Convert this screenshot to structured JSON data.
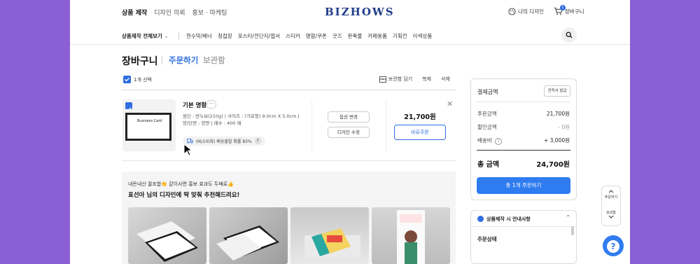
{
  "top_nav": {
    "items": [
      "상품 제작",
      "디자인 의뢰",
      "홍보 · 마케팅"
    ]
  },
  "logo": "BIZHOWS",
  "top_right": {
    "my_design": "나의 디자인",
    "cart": "장바구니",
    "cart_count": "1"
  },
  "category_bar": {
    "all_label": "상품제작 전체보기",
    "items": [
      "현수막/배너",
      "청첩장",
      "포스터/전단지/엽서",
      "스티커",
      "명함/쿠폰",
      "굿즈",
      "판촉물",
      "카페용품",
      "기획전",
      "이색상품"
    ]
  },
  "cart_header": {
    "title": "장바구니",
    "tab_order": "주문하기",
    "tab_keep": "보관함"
  },
  "selection": {
    "count_label": "1개 선택",
    "keep_label": "보관함 담기",
    "copy_label": "복제",
    "delete_label": "삭제"
  },
  "product": {
    "name": "기본 명함",
    "more": "···",
    "desc_line1": "원단 : 반누보(210g) | 사이즈 : (가로형) 9.0cm X 5.0cm |",
    "desc_line2": "양/단면 : 양면 | 매수 : 400 매",
    "shipping": "06/10(화) 배송출발 확률 83%",
    "shipping_help": "?",
    "card_text": "Business Card",
    "option_change": "옵션 변경",
    "design_edit": "디자인 수정",
    "price": "21,700원",
    "order_now": "바로주문",
    "close": "✕"
  },
  "recommend": {
    "subtitle": "내돈내산 꿀조합👏 같이사면 홍보 효과도 두배로👍",
    "title": "표선아 님의 디자인에 딱 맞춰 추천해드려요!"
  },
  "summary": {
    "header": "결제금액",
    "estimate_btn": "견적서 발급",
    "rows": [
      {
        "label": "주문금액",
        "value": "21,700원"
      },
      {
        "label": "할인금액",
        "value": "- 0원"
      },
      {
        "label": "배송비",
        "value": "+ 3,000원"
      }
    ],
    "total_label": "총 금액",
    "total_value": "24,700원",
    "pay_button": "총 1개 주문하기"
  },
  "notice": {
    "title": "상품제작 시 안내사항",
    "status": "주문상태"
  },
  "side_float": {
    "up_label": "주문하기",
    "down_label": "보관함"
  },
  "help": "?",
  "colors": {
    "accent": "#2f6fe0",
    "button": "#2f7cf0",
    "background": "#8b5fd6"
  }
}
